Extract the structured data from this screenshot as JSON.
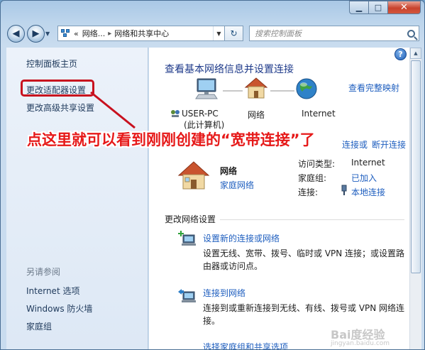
{
  "window": {
    "caption": {
      "minimize": "▁",
      "maximize": "□",
      "close": "✕"
    }
  },
  "nav": {
    "back_icon": "back-arrow-icon",
    "forward_icon": "forward-arrow-icon",
    "address": {
      "prefix": "«",
      "segment1": "网络...",
      "separator": "▸",
      "segment2": "网络和共享中心"
    },
    "refresh_glyph": "↻",
    "search_placeholder": "搜索控制面板"
  },
  "sidebar": {
    "home": "控制面板主页",
    "change_adapter": "更改适配器设置",
    "change_sharing": "更改高级共享设置",
    "see_also": "另请参阅",
    "internet_options": "Internet 选项",
    "firewall": "Windows 防火墙",
    "homegroup": "家庭组"
  },
  "main": {
    "title": "查看基本网络信息并设置连接",
    "view_full_map": "查看完整映射",
    "map": {
      "computer_name": "USER-PC",
      "computer_sub": "(此计算机)",
      "network": "网络",
      "internet": "Internet"
    },
    "partial_link_1": "连接或",
    "partial_link_2": "断开连接",
    "active_network": {
      "name": "网络",
      "type": "家庭网络",
      "access_type_label": "访问类型:",
      "access_type_value": "Internet",
      "homegroup_label": "家庭组:",
      "homegroup_value": "已加入",
      "connections_label": "连接:",
      "connections_value": "本地连接"
    },
    "change_settings_title": "更改网络设置",
    "tasks": [
      {
        "title": "设置新的连接或网络",
        "desc": "设置无线、宽带、拨号、临时或 VPN 连接；或设置路由器或访问点。"
      },
      {
        "title": "连接到网络",
        "desc": "连接到或重新连接到无线、有线、拨号或 VPN 网络连接。"
      },
      {
        "title": "选择家庭组和共享选项"
      }
    ]
  },
  "annotation": {
    "text": "点这里就可以看到刚刚创建的“宽带连接”了",
    "color": "#e61919"
  },
  "watermark": {
    "main": "Bai度经验",
    "sub": "jingyan.baidu.com"
  },
  "colors": {
    "link": "#1e5ebf",
    "title": "#1e3a8a",
    "highlight": "#c8101e"
  }
}
